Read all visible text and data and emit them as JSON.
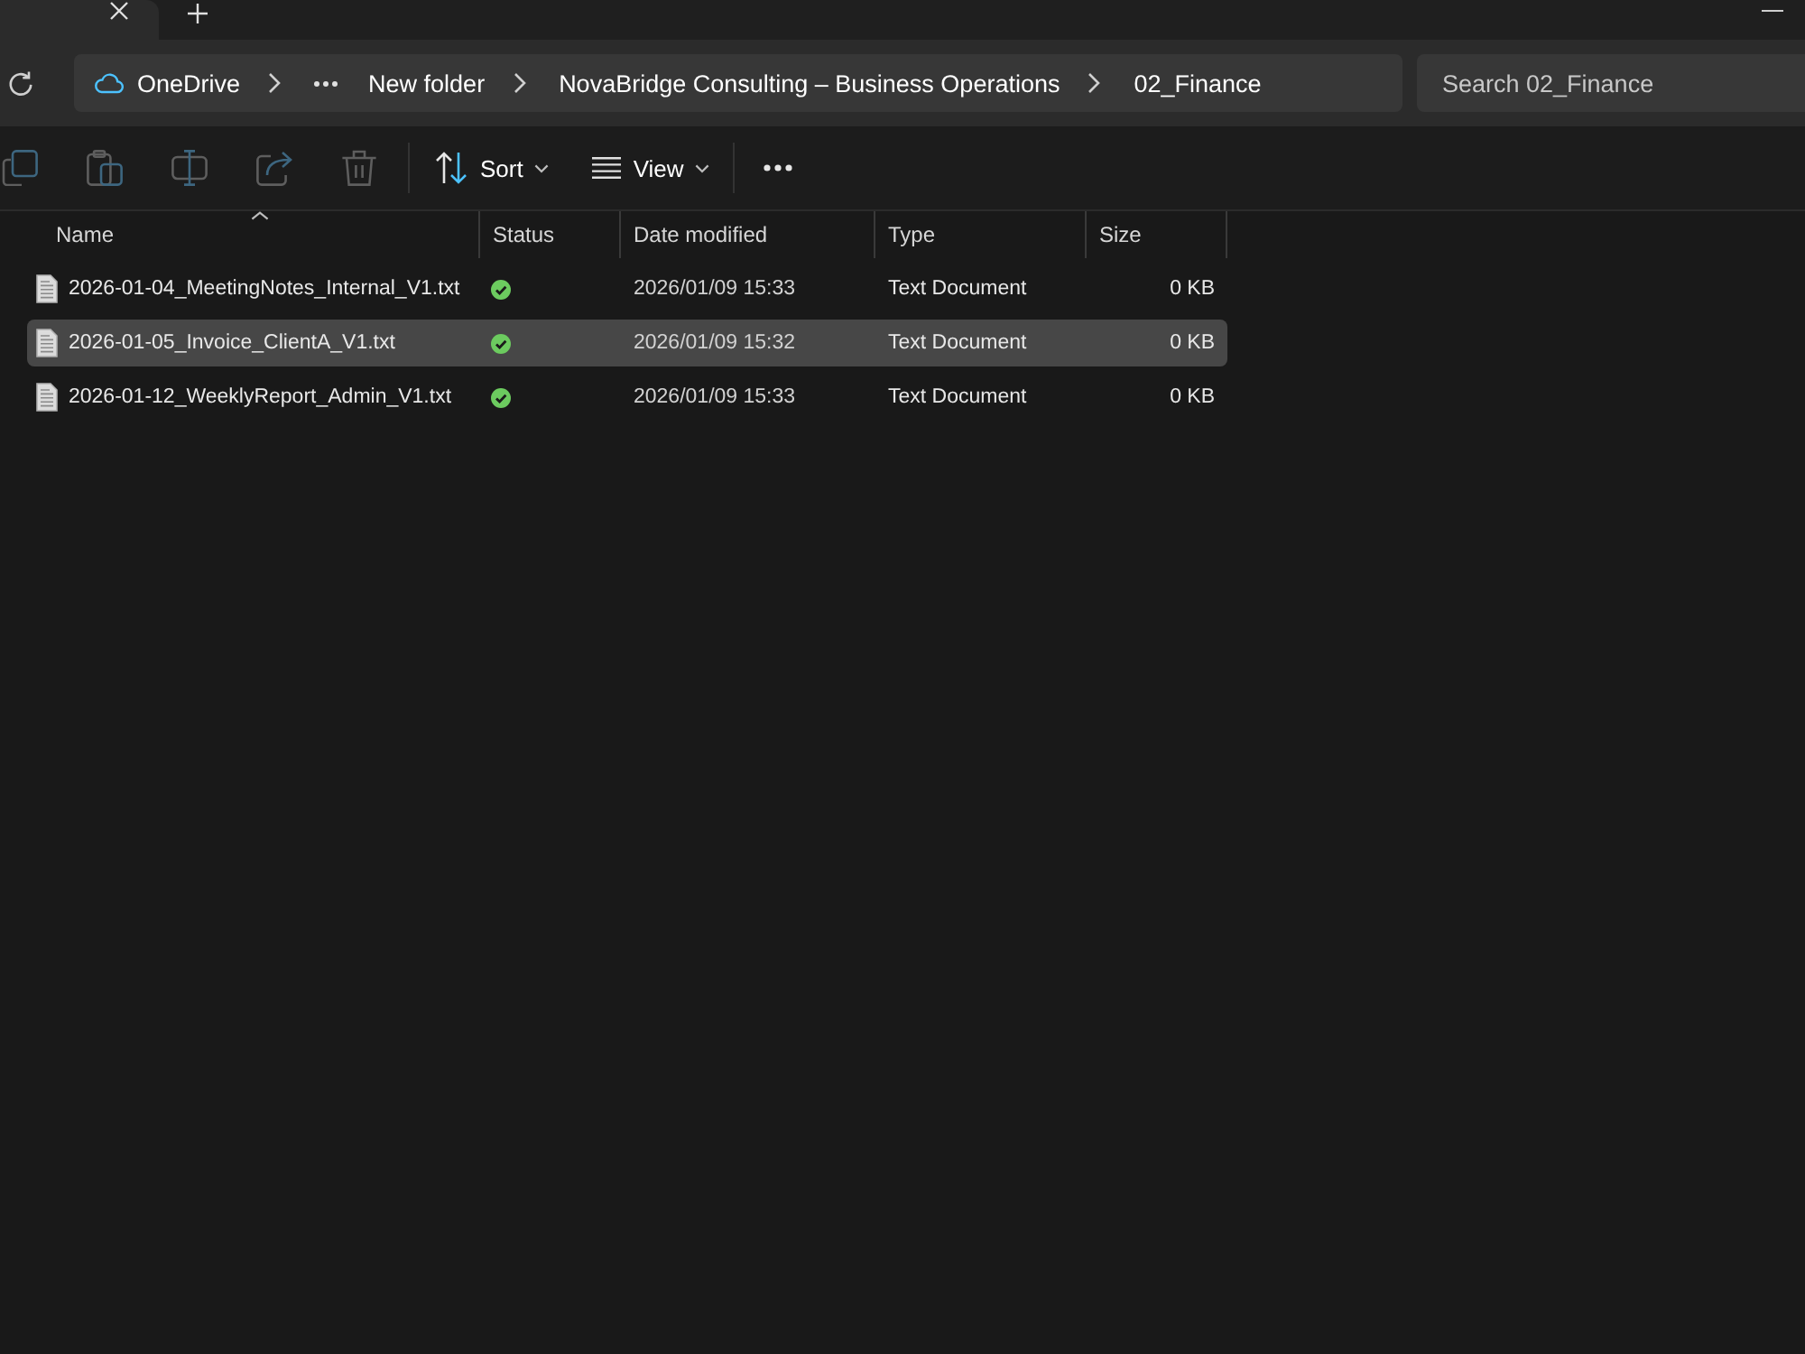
{
  "breadcrumb": {
    "root": "OneDrive",
    "collapsed": true,
    "items": [
      "New folder",
      "NovaBridge Consulting – Business Operations",
      "02_Finance"
    ]
  },
  "search": {
    "placeholder": "Search 02_Finance"
  },
  "toolbar": {
    "icon_buttons": [
      {
        "disabled": true
      },
      {
        "disabled": true
      },
      {
        "disabled": true
      },
      {
        "disabled": true
      },
      {
        "disabled": true
      }
    ],
    "buttons": [
      {
        "label": "Sort"
      },
      {
        "label": "View"
      }
    ]
  },
  "columns": [
    {
      "label": "Name",
      "sorted": true
    },
    {
      "label": "Status",
      "sorted": false
    },
    {
      "label": "Date modified",
      "sorted": false
    },
    {
      "label": "Type",
      "sorted": false
    },
    {
      "label": "Size",
      "sorted": false
    }
  ],
  "rows": [
    {
      "name": "2026-01-04_MeetingNotes_Internal_V1.txt",
      "synced": true,
      "date": "2026/01/09 15:33",
      "type": "Text Document",
      "size": "0 KB",
      "selected": false
    },
    {
      "name": "2026-01-05_Invoice_ClientA_V1.txt",
      "synced": true,
      "date": "2026/01/09 15:32",
      "type": "Text Document",
      "size": "0 KB",
      "selected": true
    },
    {
      "name": "2026-01-12_WeeklyReport_Admin_V1.txt",
      "synced": true,
      "date": "2026/01/09 15:33",
      "type": "Text Document",
      "size": "0 KB",
      "selected": false
    }
  ]
}
